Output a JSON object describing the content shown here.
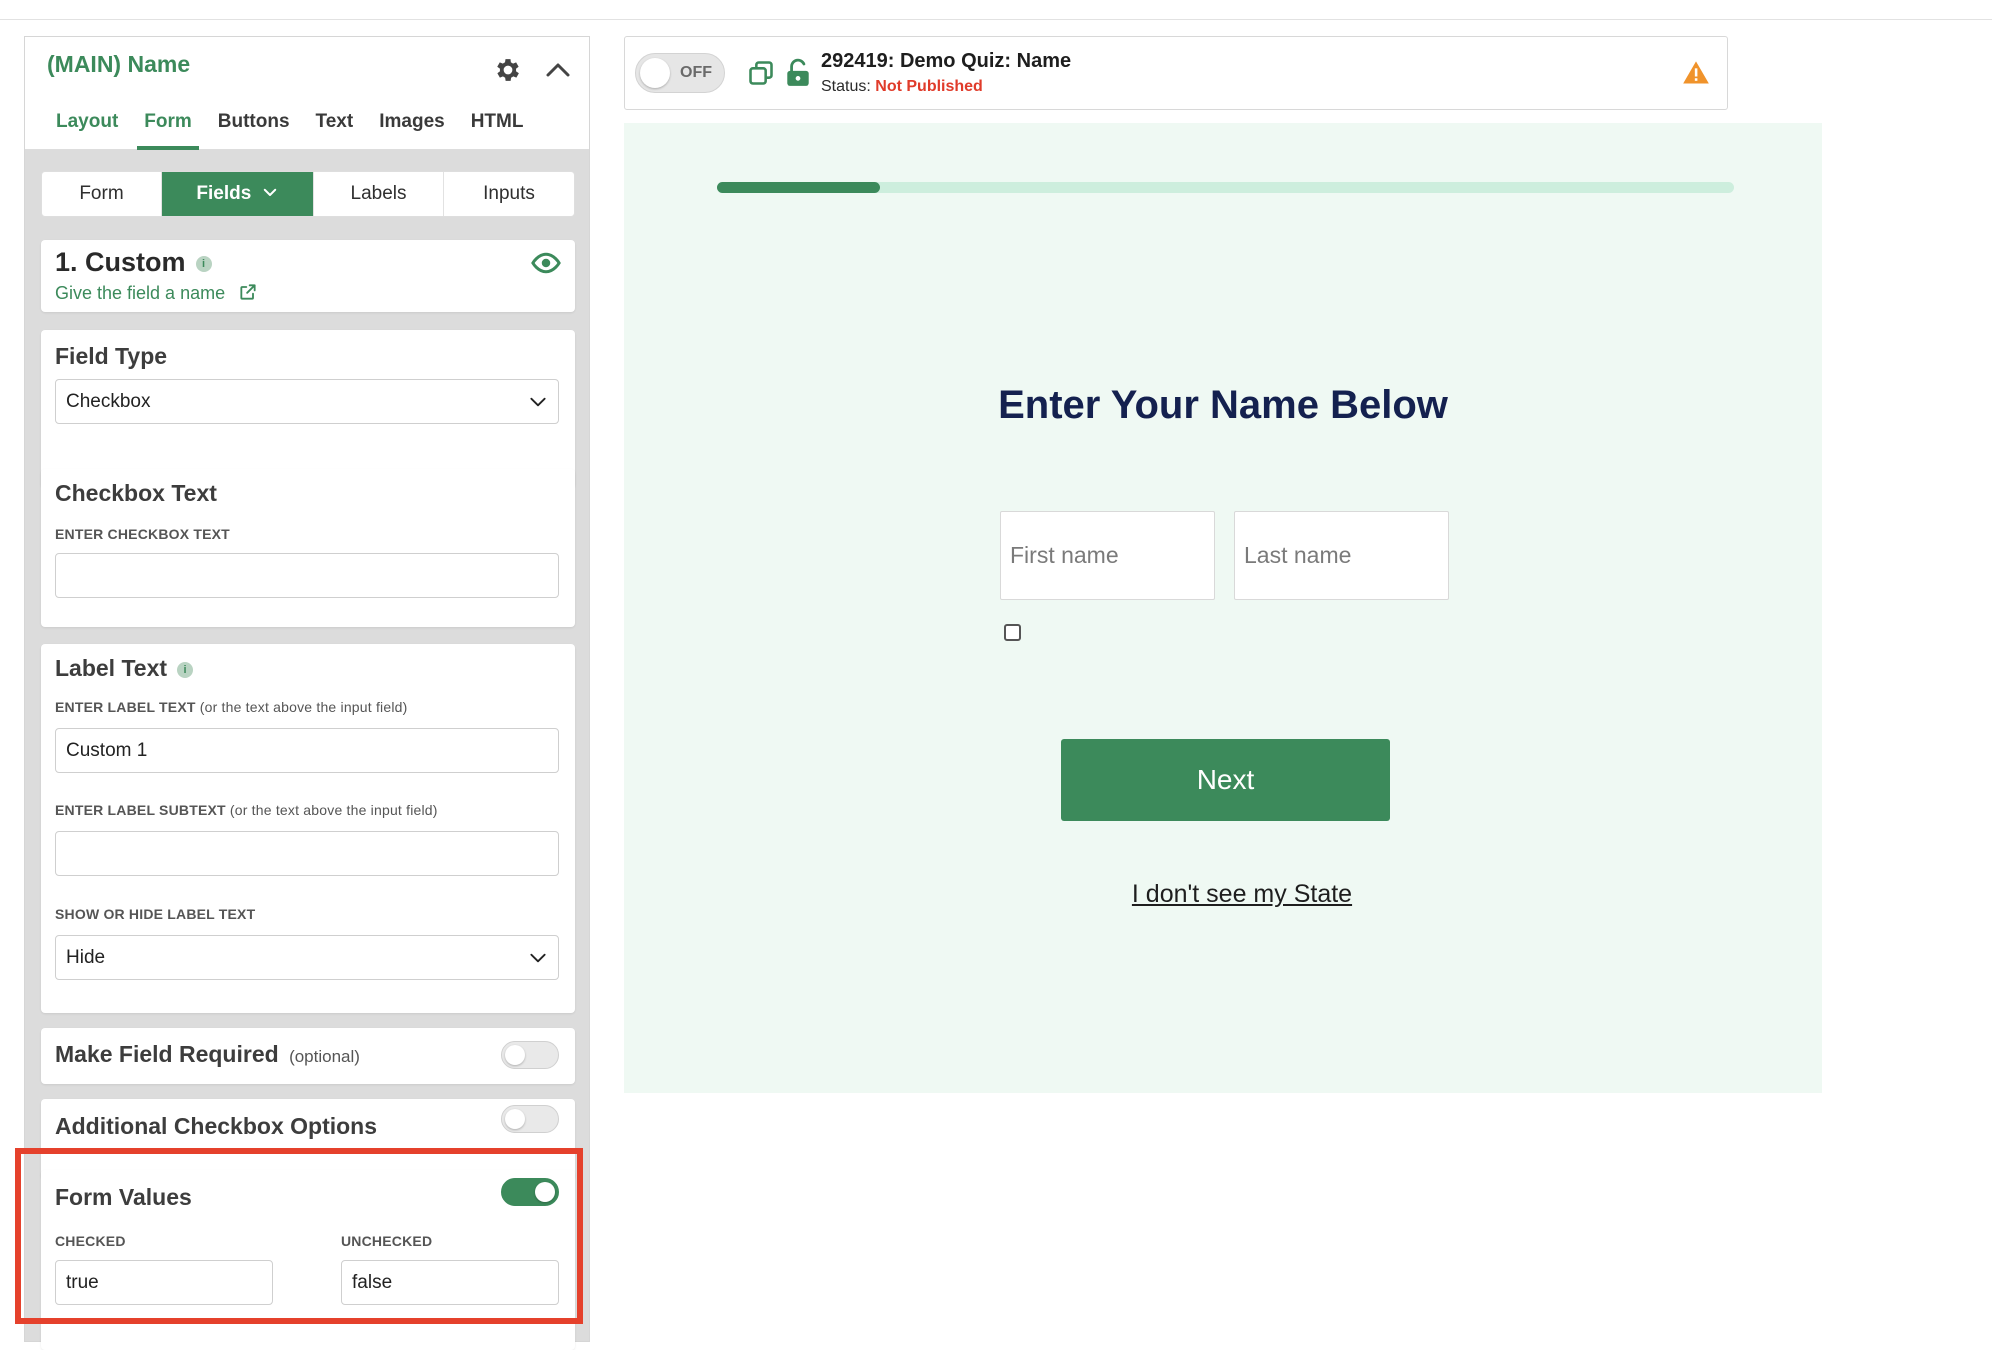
{
  "panel": {
    "title": "(MAIN) Name",
    "tabs": [
      "Layout",
      "Form",
      "Buttons",
      "Text",
      "Images",
      "HTML"
    ],
    "active_tab": "Form",
    "subtabs": [
      "Form",
      "Fields",
      "Labels",
      "Inputs"
    ],
    "active_subtab": "Fields",
    "field": {
      "title": "1. Custom",
      "link_text": "Give the field a name"
    },
    "field_type": {
      "heading": "Field Type",
      "value": "Checkbox"
    },
    "checkbox_text": {
      "heading": "Checkbox Text",
      "label": "ENTER CHECKBOX TEXT",
      "value": ""
    },
    "label_text": {
      "heading": "Label Text",
      "label_bold": "ENTER LABEL TEXT",
      "label_note": "(or the text above the input field)",
      "value": "Custom 1",
      "subtext_bold": "ENTER LABEL SUBTEXT",
      "subtext_note": "(or the text above the input field)",
      "subtext_value": "",
      "show_hide_label": "SHOW OR HIDE LABEL TEXT",
      "show_hide_value": "Hide"
    },
    "required": {
      "heading": "Make Field Required",
      "note": "(optional)",
      "enabled": false
    },
    "additional": {
      "heading": "Additional Checkbox Options",
      "enabled": false
    },
    "form_values": {
      "heading": "Form Values",
      "enabled": true,
      "checked_label": "CHECKED",
      "checked_value": "true",
      "unchecked_label": "UNCHECKED",
      "unchecked_value": "false"
    }
  },
  "topbar": {
    "toggle_label": "OFF",
    "quiz_title": "292419: Demo Quiz: Name",
    "status_label": "Status:",
    "status_value": "Not Published"
  },
  "preview": {
    "progress": 0.16,
    "headline": "Enter Your Name Below",
    "first_name_placeholder": "First name",
    "last_name_placeholder": "Last name",
    "next_label": "Next",
    "link_text": "I don't see my State"
  },
  "colors": {
    "brand_green": "#3c8a5b",
    "preview_bg": "#eff9f3",
    "headline": "#14214f",
    "not_published": "#e03b2a",
    "highlight": "#e5412c",
    "warning": "#f0932b"
  }
}
